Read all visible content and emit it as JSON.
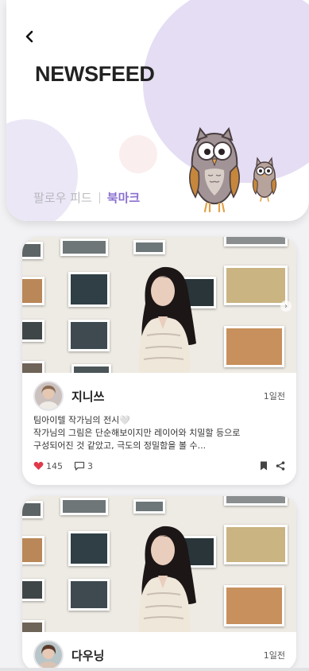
{
  "header": {
    "back_icon": "chevron-left-icon",
    "title": "NEWSFEED",
    "tabs": [
      {
        "label": "팔로우 피드",
        "active": false
      },
      {
        "label": "북마크",
        "active": true
      }
    ],
    "accent_color": "#8a6fd0",
    "blob_color": "#e4ddf3"
  },
  "feed": [
    {
      "author": "지니쓰",
      "time": "1일전",
      "caption_line1": "팀아이텔 작가님의 전시🤍",
      "caption_line2": "작가님의 그림은 단순해보이지만 레이어와 치밀할 등으로",
      "caption_line3": "구성되어진 것 같았고, 극도의 정밀함을 볼 수...",
      "likes": "145",
      "comments": "3",
      "icons": [
        "heart-icon",
        "comment-icon",
        "bookmark-icon",
        "share-icon"
      ]
    },
    {
      "author": "다우닝",
      "time": "1일전"
    }
  ]
}
